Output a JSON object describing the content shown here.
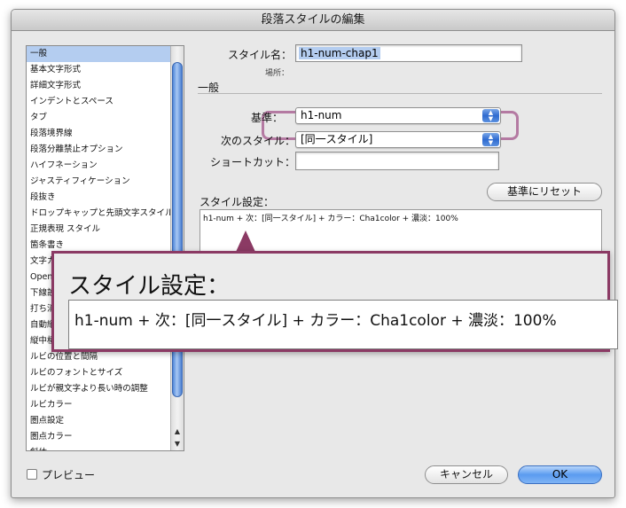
{
  "window": {
    "title": "段落スタイルの編集"
  },
  "sidebar": {
    "items": [
      "一般",
      "基本文字形式",
      "詳細文字形式",
      "インデントとスペース",
      "タブ",
      "段落境界線",
      "段落分離禁止オプション",
      "ハイフネーション",
      "ジャスティフィケーション",
      "段抜き",
      "ドロップキャップと先頭文字スタイル",
      "正規表現 スタイル",
      "箇条書き",
      "文字カ",
      "Open",
      "下線設",
      "打ち消",
      "自動縦",
      "縦中横",
      "ルビの位置と間隔",
      "ルビのフォントとサイズ",
      "ルビが親文字より長い時の調整",
      "ルビカラー",
      "圏点設定",
      "圏点カラー",
      "斜体"
    ],
    "selected_index": 0
  },
  "form": {
    "style_name_label": "スタイル名：",
    "style_name_value": "h1-num-chap1",
    "location_label": "場所：",
    "section_title": "一般",
    "based_on_label": "基準：",
    "based_on_value": "h1-num",
    "next_style_label": "次のスタイル：",
    "next_style_value": "[同一スタイル]",
    "shortcut_label": "ショートカット：",
    "shortcut_value": "",
    "reset_button": "基準にリセット",
    "style_settings_label": "スタイル設定：",
    "style_settings_value": "h1-num + 次：[同一スタイル] + カラー：Cha1color + 濃淡：100%"
  },
  "footer": {
    "preview_label": "プレビュー",
    "preview_checked": false,
    "cancel_button": "キャンセル",
    "ok_button": "OK"
  },
  "callout": {
    "title": "スタイル設定：",
    "value": "h1-num + 次：[同一スタイル] + カラー：Cha1color + 濃淡：100%"
  },
  "colors": {
    "highlight_border": "#b47aa2",
    "callout_border": "#8b3a64",
    "selection": "#b4cdf0",
    "ok_button": "#5a9bf0"
  }
}
